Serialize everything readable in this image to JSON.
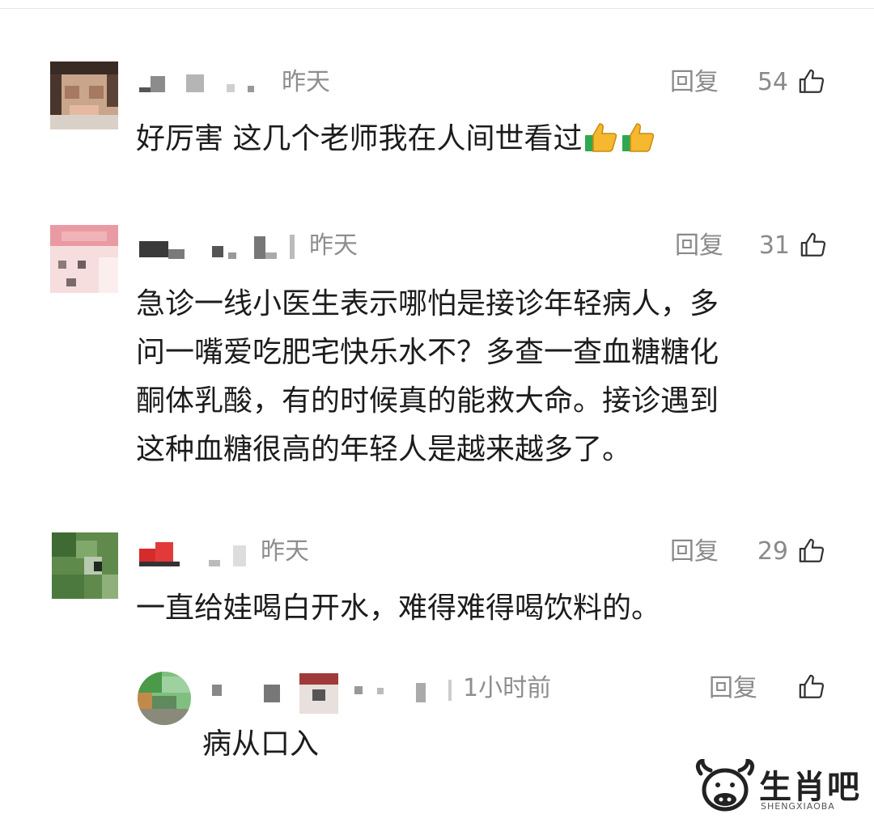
{
  "comments": [
    {
      "time": "昨天",
      "reply": "回复",
      "likes": "54",
      "text": "好厉害 这几个老师我在人间世看过"
    },
    {
      "time": "昨天",
      "reply": "回复",
      "likes": "31",
      "lines": [
        "急诊一线小医生表示哪怕是接诊年轻病人，多",
        "问一嘴爱吃肥宅快乐水不？多查一查血糖糖化",
        "酮体乳酸，有的时候真的能救大命。接诊遇到",
        "这种血糖很高的年轻人是越来越多了。"
      ]
    },
    {
      "time": "昨天",
      "reply": "回复",
      "likes": "29",
      "text": "一直给娃喝白开水，难得难得喝饮料的。"
    }
  ],
  "sub_reply": {
    "time": "1小时前",
    "reply": "回复",
    "text": "病从口入"
  },
  "watermark": {
    "name": "生肖吧",
    "sub": "SHENGXIAOBA"
  },
  "icons": {
    "like": "thumbs-up-outline-icon",
    "emoji": "thumbs-up-emoji-icon"
  },
  "colors": {
    "meta_gray": "#8e8e8e",
    "text": "#1c1c1c"
  }
}
